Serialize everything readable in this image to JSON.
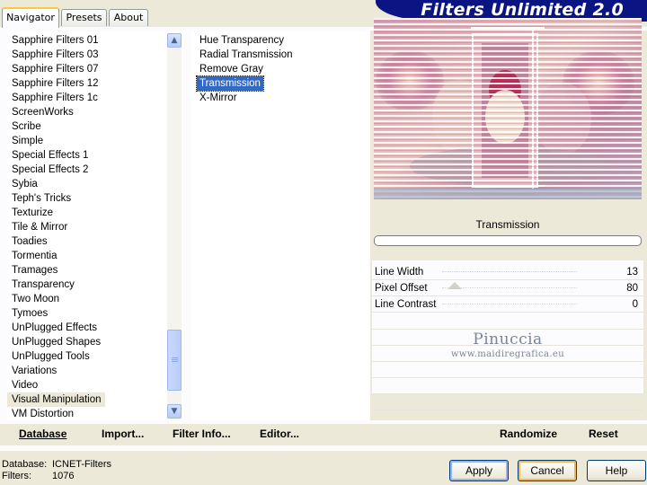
{
  "tabs": [
    {
      "label": "Navigator",
      "active": true
    },
    {
      "label": "Presets",
      "active": false
    },
    {
      "label": "About",
      "active": false
    }
  ],
  "banner": {
    "title": "Filters Unlimited 2.0"
  },
  "categories": {
    "items": [
      "Sapphire Filters 01",
      "Sapphire Filters 03",
      "Sapphire Filters 07",
      "Sapphire Filters 12",
      "Sapphire Filters 1c",
      "ScreenWorks",
      "Scribe",
      "Simple",
      "Special Effects 1",
      "Special Effects 2",
      "Sybia",
      "Teph's Tricks",
      "Texturize",
      "Tile & Mirror",
      "Toadies",
      "Tormentia",
      "Tramages",
      "Transparency",
      "Two Moon",
      "Tymoes",
      "UnPlugged Effects",
      "UnPlugged Shapes",
      "UnPlugged Tools",
      "Variations",
      "Video",
      "Visual Manipulation",
      "VM Distortion"
    ],
    "selected": "Visual Manipulation"
  },
  "filters": {
    "items": [
      "Hue Transparency",
      "Radial Transmission",
      "Remove Gray",
      "Transmission",
      "X-Mirror"
    ],
    "selected": "Transmission"
  },
  "toolbar": {
    "database": "Database",
    "import": "Import...",
    "filter_info": "Filter Info...",
    "editor": "Editor...",
    "randomize": "Randomize",
    "reset": "Reset"
  },
  "filter_panel": {
    "title": "Transmission",
    "progress": 0,
    "params": [
      {
        "label": "Line Width",
        "value": "13"
      },
      {
        "label": "Pixel Offset",
        "value": "80"
      },
      {
        "label": "Line Contrast",
        "value": "0"
      }
    ],
    "watermark": "Pinuccia",
    "watermark_url": "www.maidiregrafica.eu"
  },
  "info": {
    "database_label": "Database:",
    "database_value": "ICNET-Filters",
    "filters_label": "Filters:",
    "filters_value": "1076"
  },
  "buttons": {
    "apply": "Apply",
    "cancel": "Cancel",
    "help": "Help"
  },
  "colors": {
    "banner": "#0a1583",
    "selection": "#316ac5",
    "panel": "#ece9d8",
    "active_tab": "#ffc83c"
  }
}
